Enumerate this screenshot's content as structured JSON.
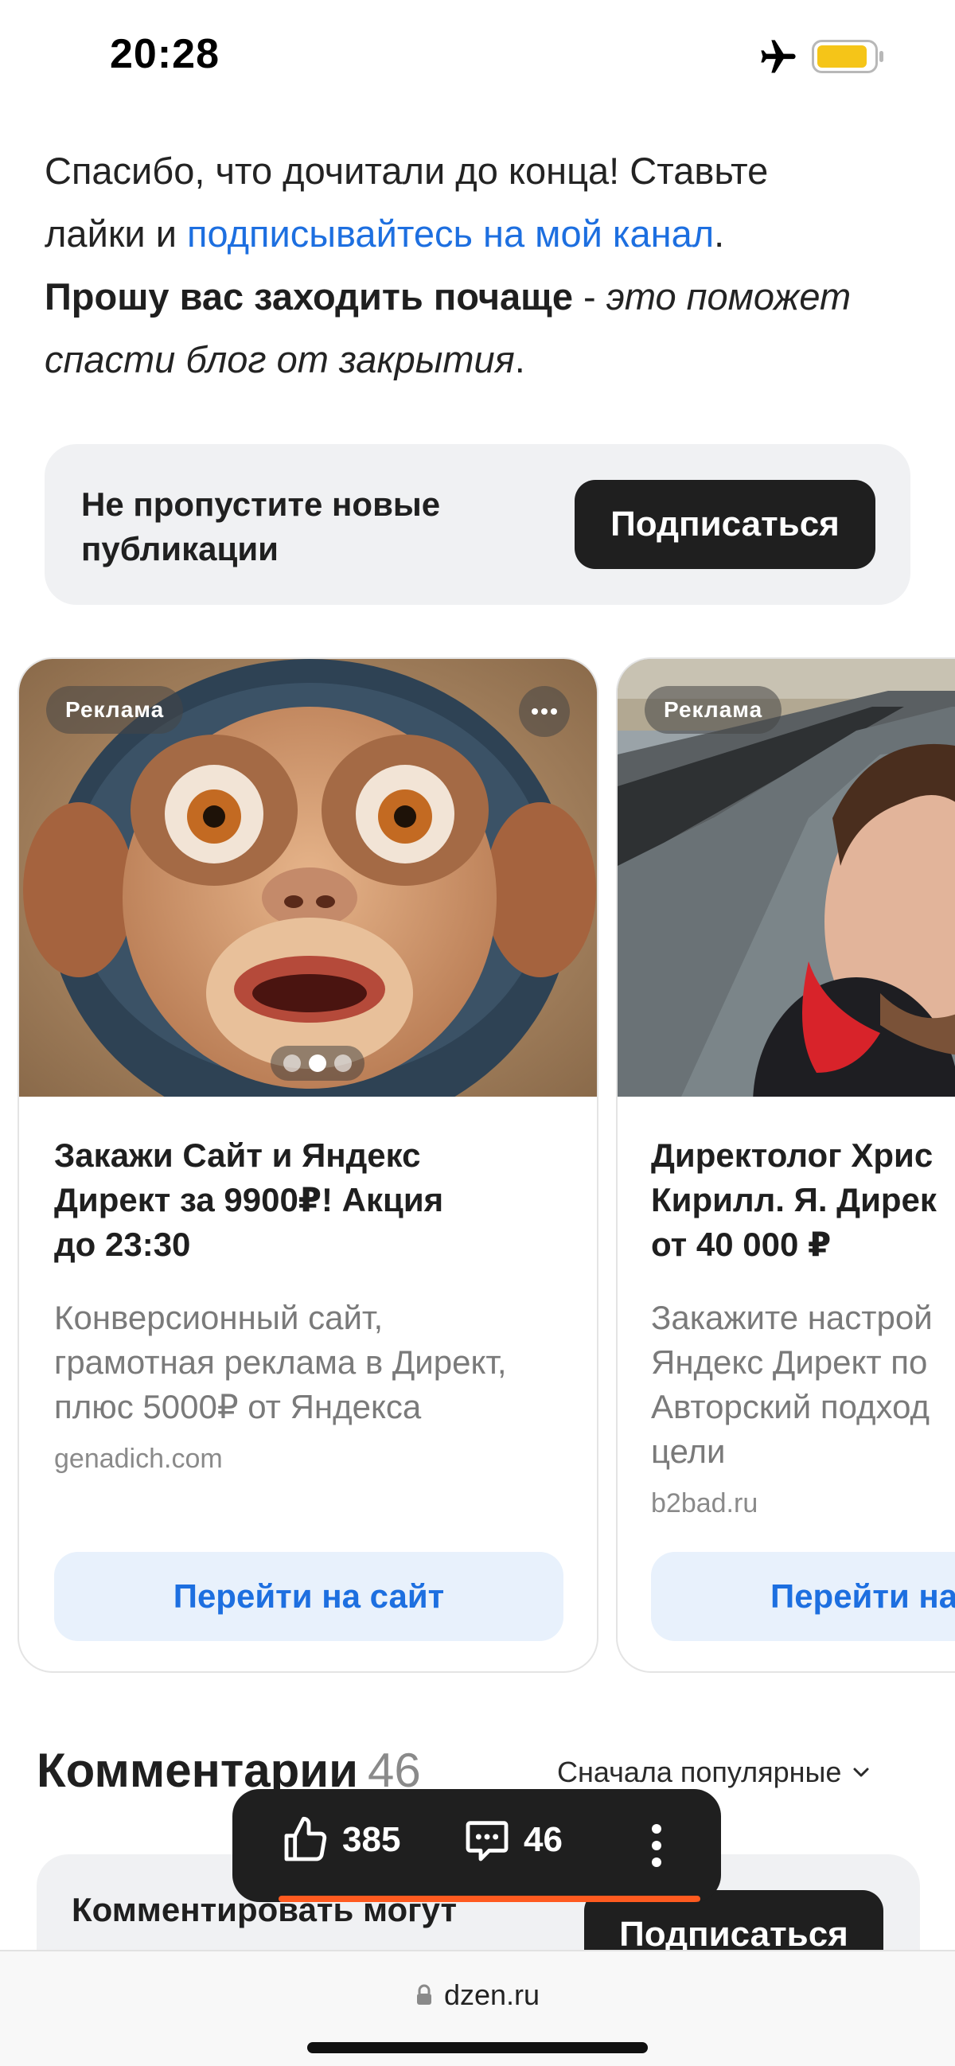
{
  "status_bar": {
    "time": "20:28",
    "icons": [
      "airplane-icon",
      "battery-icon"
    ],
    "battery_color": "#f5c518"
  },
  "article": {
    "line1": "Спасибо, что дочитали до конца! Ставьте",
    "line2_prefix": "лайки и ",
    "line2_link": "подписывайтесь на мой канал",
    "line2_suffix": ".",
    "line3_bold": "Прошу вас заходить почаще",
    "line3_dash": " - ",
    "line3_italic": "это поможет",
    "line4_italic": "спасти блог от закрытия",
    "line4_suffix": "."
  },
  "subscribe_banner": {
    "text_line1": "Не пропустите новые",
    "text_line2": "публикации",
    "button_label": "Подписаться"
  },
  "ads": [
    {
      "badge": "Реклама",
      "title_lines": [
        "Закажи Сайт и Яндекс",
        "Директ за 9900₽! Акция",
        "до 23:30"
      ],
      "desc_lines": [
        "Конверсионный сайт,",
        "грамотная реклама в Директ,",
        "плюс 5000₽ от Яндекса"
      ],
      "domain": "genadich.com",
      "cta": "Перейти на сайт"
    },
    {
      "badge": "Реклама",
      "title_lines": [
        "Директолог Хрис",
        "Кирилл. Я. Дирек",
        "от 40 000 ₽"
      ],
      "desc_lines": [
        "Закажите настрой",
        "Яндекс Директ по",
        "Авторский подход",
        "цели"
      ],
      "domain": "b2bad.ru",
      "cta": "Перейти на"
    }
  ],
  "comments": {
    "heading": "Комментарии",
    "count": "46",
    "sort_label": "Сначала популярные",
    "box_text": "Комментировать могут",
    "subscribe_label": "Подписаться"
  },
  "action_bar": {
    "likes": "385",
    "comments": "46",
    "accent_color": "#ff5a1f"
  },
  "browser": {
    "url": "dzen.ru"
  }
}
